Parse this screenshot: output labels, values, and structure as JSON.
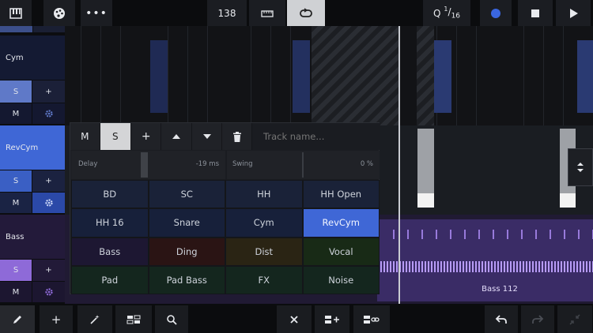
{
  "topbar": {
    "tempo": "138",
    "quantize": {
      "q": "Q",
      "num": "1",
      "den": "16"
    },
    "loop_active": true
  },
  "tracks": [
    {
      "name": "Cym",
      "color": "#141a33",
      "s_color": "#5f79c8",
      "m_label": "M",
      "s_label": "S",
      "add_label": "+"
    },
    {
      "name": "RevCym",
      "color": "#3f67d6",
      "s_color": "#3f67d6",
      "m_label": "M",
      "s_label": "S",
      "add_label": "+"
    },
    {
      "name": "Bass",
      "color": "#231a3a",
      "s_color": "#8e6ad8",
      "m_label": "M",
      "s_label": "S",
      "add_label": "+"
    }
  ],
  "popup": {
    "m_label": "M",
    "s_label": "S",
    "add_label": "+",
    "track_name_placeholder": "Track name...",
    "delay": {
      "label": "Delay",
      "value": "-19 ms",
      "level": 0.5
    },
    "swing": {
      "label": "Swing",
      "value": "0 %",
      "level": 0.0
    },
    "instruments": [
      [
        "BD",
        "SC",
        "HH",
        "HH Open"
      ],
      [
        "HH 16",
        "Snare",
        "Cym",
        "RevCym"
      ],
      [
        "Bass",
        "Ding",
        "Dist",
        "Vocal"
      ],
      [
        "Pad",
        "Pad Bass",
        "FX",
        "Noise"
      ]
    ],
    "selected": "RevCym",
    "row_colors": [
      "#1a2238",
      "#17203a",
      "#1d1732",
      "#14261e"
    ]
  },
  "clip_label": "Bass 112",
  "colors": {
    "accent": "#3f67d6",
    "bass": "#7a4fcf",
    "record": "#3a66e0"
  }
}
